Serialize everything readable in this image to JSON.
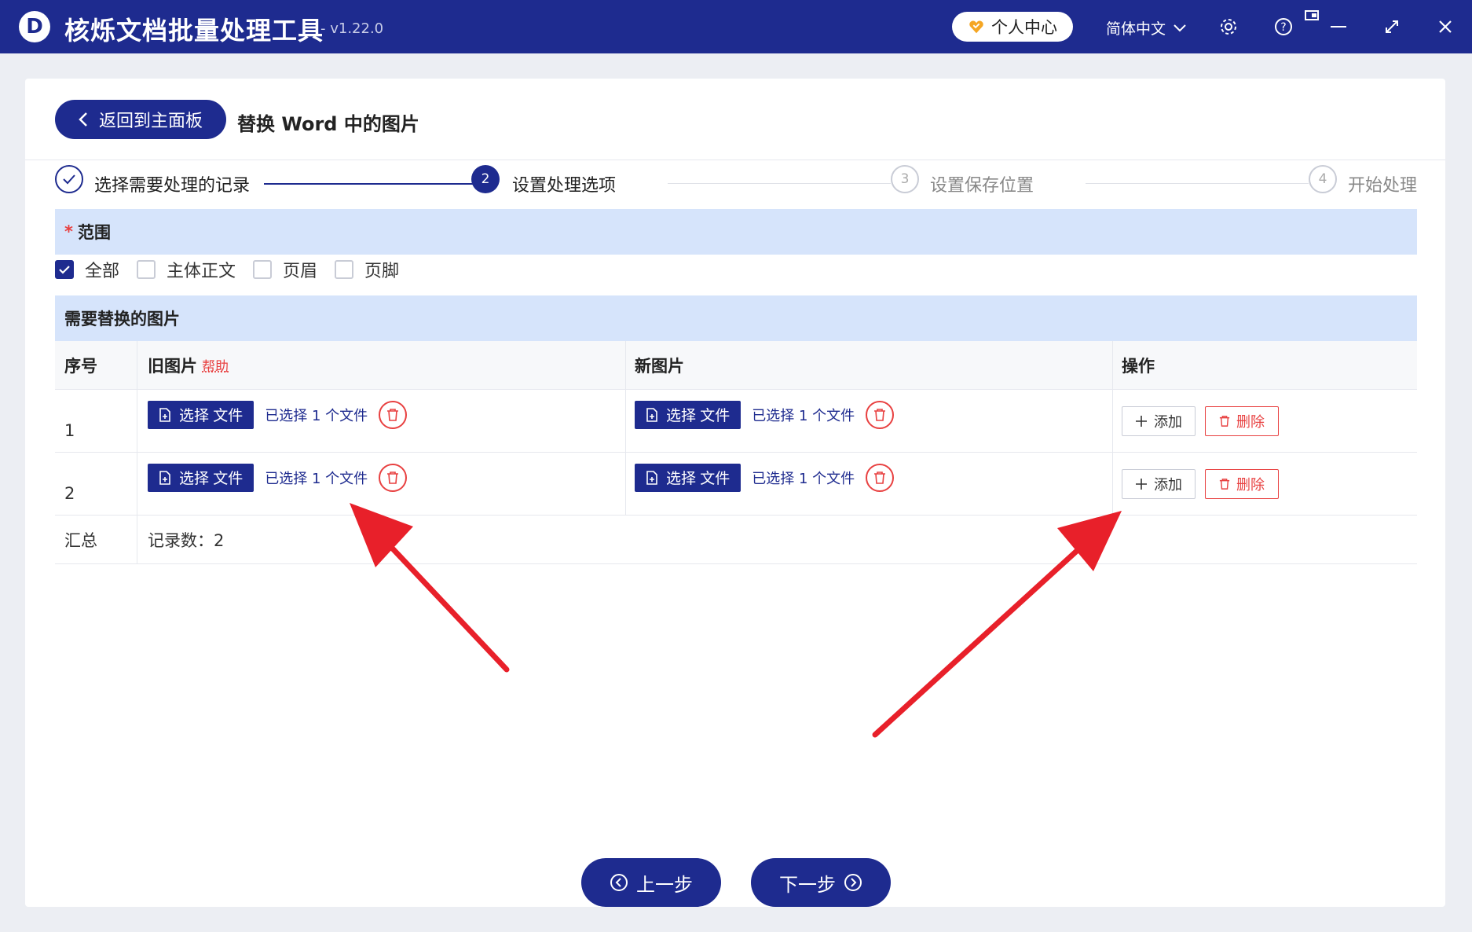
{
  "titlebar": {
    "app_title": "核烁文档批量处理工具",
    "version": "- v1.22.0",
    "user_center": "个人中心",
    "language": "简体中文",
    "brand_color": "#1e2b8f"
  },
  "header": {
    "back_button": "返回到主面板",
    "page_title": "替换 Word 中的图片"
  },
  "steps": [
    {
      "index": "✓",
      "label": "选择需要处理的记录",
      "state": "done"
    },
    {
      "index": "2",
      "label": "设置处理选项",
      "state": "active"
    },
    {
      "index": "3",
      "label": "设置保存位置",
      "state": "pending"
    },
    {
      "index": "4",
      "label": "开始处理",
      "state": "pending"
    }
  ],
  "scope": {
    "title": "范围",
    "required_mark": "*",
    "options": [
      {
        "label": "全部",
        "checked": true
      },
      {
        "label": "主体正文",
        "checked": false
      },
      {
        "label": "页眉",
        "checked": false
      },
      {
        "label": "页脚",
        "checked": false
      }
    ]
  },
  "images": {
    "title": "需要替换的图片",
    "columns": {
      "index": "序号",
      "old": "旧图片",
      "help": "帮助",
      "new": "新图片",
      "actions": "操作"
    },
    "rows": [
      {
        "index": "1",
        "old_button": "选择 文件",
        "old_status": "已选择 1 个文件",
        "new_button": "选择 文件",
        "new_status": "已选择 1 个文件",
        "add": "添加",
        "delete": "删除"
      },
      {
        "index": "2",
        "old_button": "选择 文件",
        "old_status": "已选择 1 个文件",
        "new_button": "选择 文件",
        "new_status": "已选择 1 个文件",
        "add": "添加",
        "delete": "删除"
      }
    ],
    "summary_label": "汇总",
    "summary_value": "记录数：2"
  },
  "footer": {
    "prev": "上一步",
    "next": "下一步"
  },
  "colors": {
    "accent": "#1e2b8f",
    "danger": "#e84040",
    "section_bg": "#d6e4fb",
    "annotation_arrow": "#e8202a"
  }
}
